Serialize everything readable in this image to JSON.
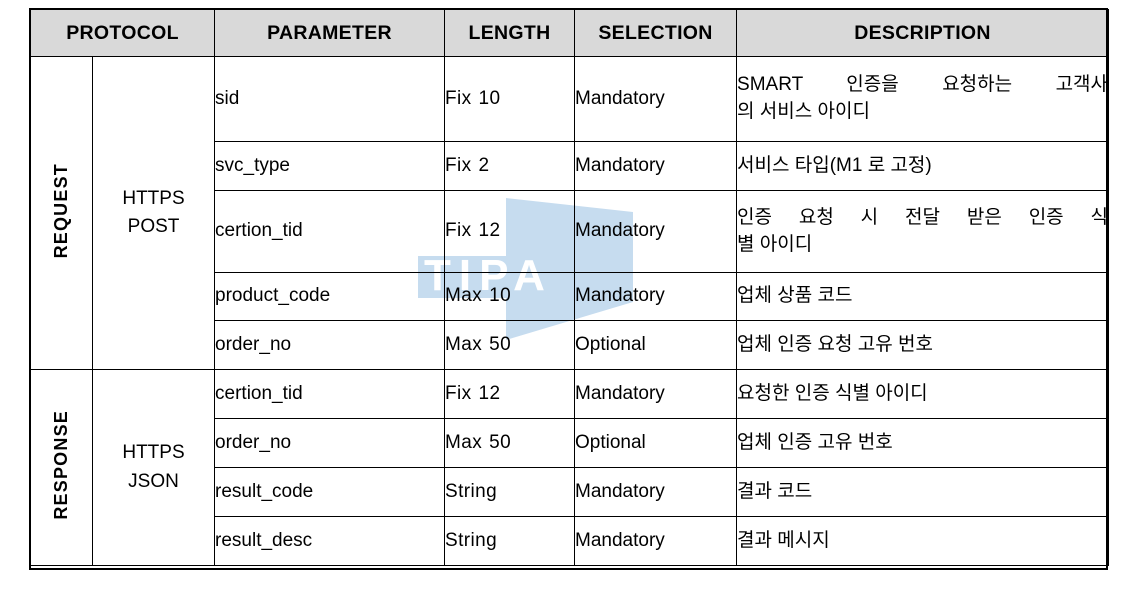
{
  "document": {
    "kind": "api-specification-table",
    "watermark_text": "TIPA",
    "watermark_color": "#c6dcef",
    "header_background": "#d9d9d9",
    "border_color": "#000000"
  },
  "table": {
    "headers": [
      {
        "key": "protocol",
        "label": "PROTOCOL"
      },
      {
        "key": "parameter",
        "label": "PARAMETER"
      },
      {
        "key": "length",
        "label": "LENGTH"
      },
      {
        "key": "selection",
        "label": "SELECTION"
      },
      {
        "key": "description",
        "label": "DESCRIPTION"
      }
    ],
    "sections": [
      {
        "id": "request",
        "label": "REQUEST",
        "protocol_line1": "HTTPS",
        "protocol_line2": "POST",
        "rows": [
          {
            "parameter": "sid",
            "length_word": "Fix",
            "length_value": "10",
            "selection": "Mandatory",
            "description_line1": "SMART 인증을 요청하는 고객사",
            "description_line2": "의 서비스 아이디",
            "description": "SMART 인증을 요청하는 고객사의 서비스 아이디"
          },
          {
            "parameter": "svc_type",
            "length_word": "Fix",
            "length_value": "2",
            "selection": "Mandatory",
            "description_line1": "서비스 타입(M1 로 고정)",
            "description_line2": "",
            "description": "서비스 타입(M1 로 고정)"
          },
          {
            "parameter": "certion_tid",
            "length_word": "Fix",
            "length_value": "12",
            "selection": "Mandatory",
            "description_line1": "인증 요청 시 전달 받은 인증 식",
            "description_line2": "별 아이디",
            "description": "인증 요청 시 전달 받은 인증 식별 아이디"
          },
          {
            "parameter": "product_code",
            "length_word": "Max",
            "length_value": "10",
            "selection": "Mandatory",
            "description_line1": "업체 상품 코드",
            "description_line2": "",
            "description": "업체 상품 코드"
          },
          {
            "parameter": "order_no",
            "length_word": "Max",
            "length_value": "50",
            "selection": "Optional",
            "description_line1": "업체 인증 요청 고유 번호",
            "description_line2": "",
            "description": "업체 인증 요청 고유 번호"
          }
        ]
      },
      {
        "id": "response",
        "label": "RESPONSE",
        "protocol_line1": "HTTPS",
        "protocol_line2": "JSON",
        "rows": [
          {
            "parameter": "certion_tid",
            "length_word": "Fix",
            "length_value": "12",
            "selection": "Mandatory",
            "description_line1": "요청한 인증 식별 아이디",
            "description_line2": "",
            "description": "요청한 인증 식별 아이디"
          },
          {
            "parameter": "order_no",
            "length_word": "Max",
            "length_value": "50",
            "selection": "Optional",
            "description_line1": "업체 인증 고유 번호",
            "description_line2": "",
            "description": "업체 인증 고유 번호"
          },
          {
            "parameter": "result_code",
            "length_word": "String",
            "length_value": "",
            "selection": "Mandatory",
            "description_line1": "결과 코드",
            "description_line2": "",
            "description": "결과 코드"
          },
          {
            "parameter": "result_desc",
            "length_word": "String",
            "length_value": "",
            "selection": "Mandatory",
            "description_line1": "결과 메시지",
            "description_line2": "",
            "description": "결과 메시지"
          }
        ]
      }
    ]
  }
}
